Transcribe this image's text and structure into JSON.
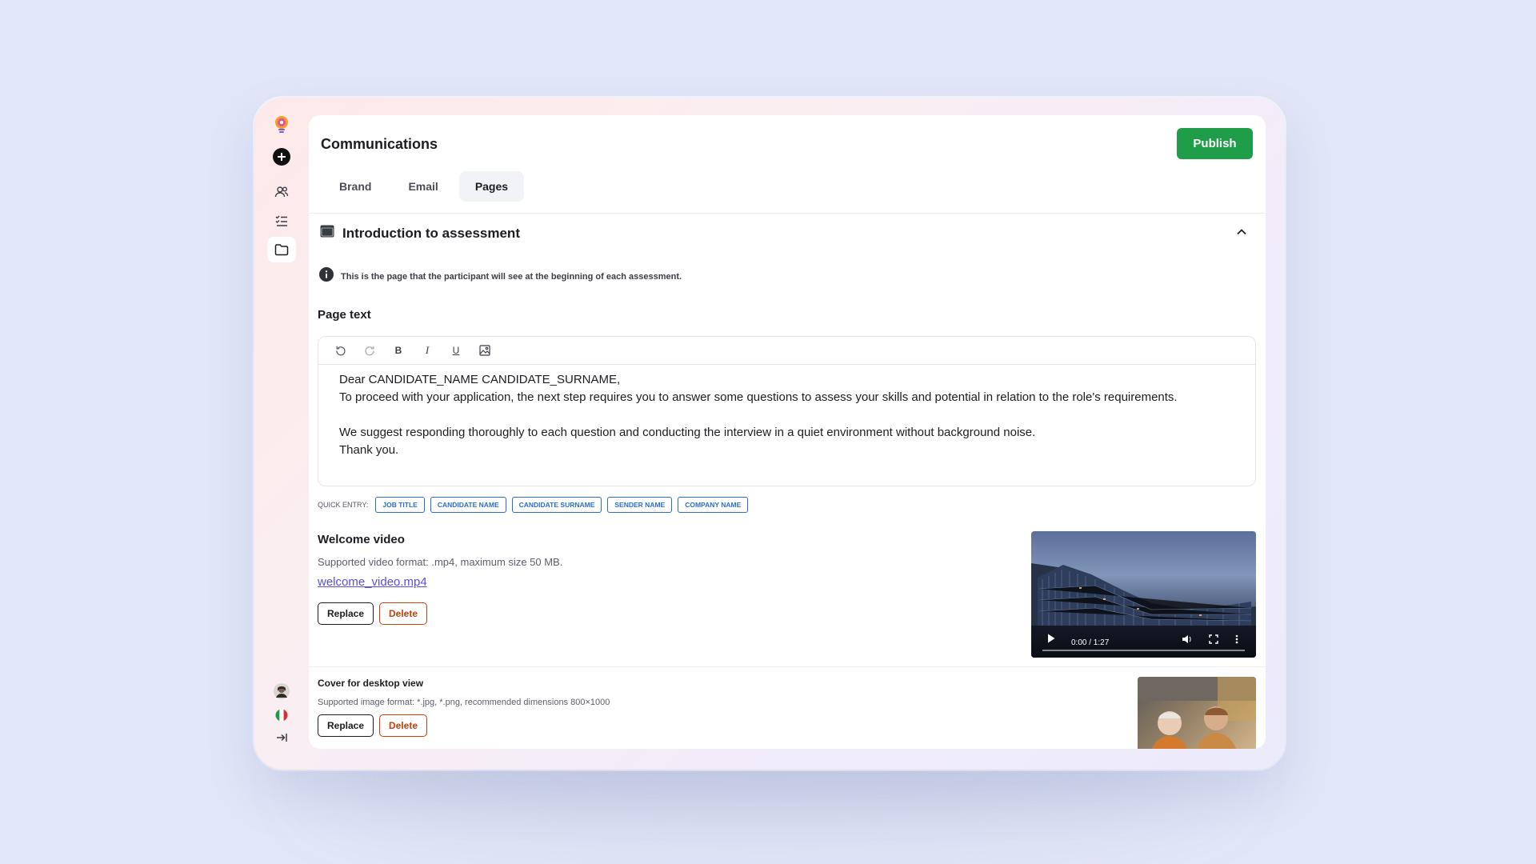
{
  "header": {
    "title": "Communications",
    "publish_label": "Publish"
  },
  "tabs": [
    {
      "label": "Brand",
      "active": false
    },
    {
      "label": "Email",
      "active": false
    },
    {
      "label": "Pages",
      "active": true
    }
  ],
  "section": {
    "title": "Introduction to assessment",
    "info": "This is the page that the participant will see at the beginning of each assessment."
  },
  "page_text": {
    "label": "Page text",
    "toolbar": [
      "undo-icon",
      "redo-icon",
      "bold-icon",
      "italic-icon",
      "underline-icon",
      "image-icon"
    ],
    "lines": [
      "Dear CANDIDATE_NAME CANDIDATE_SURNAME,",
      "To proceed with your application, the next step requires you to answer some questions to assess your skills and potential in relation to the role's requirements.",
      "",
      "We suggest responding thoroughly to each question and conducting the interview in a quiet environment without background noise.",
      "Thank you."
    ]
  },
  "quick_entry": {
    "label": "QUICK ENTRY:",
    "chips": [
      "JOB TITLE",
      "CANDIDATE NAME",
      "CANDIDATE SURNAME",
      "SENDER NAME",
      "COMPANY NAME"
    ]
  },
  "welcome_video": {
    "title": "Welcome video",
    "hint": "Supported video format: .mp4, maximum size 50 MB.",
    "file": "welcome_video.mp4",
    "replace_label": "Replace",
    "delete_label": "Delete",
    "time": "0:00 / 1:27"
  },
  "cover": {
    "title": "Cover for desktop view",
    "hint": "Supported image format: *.jpg, *.png, recommended dimensions 800×1000",
    "replace_label": "Replace",
    "delete_label": "Delete"
  },
  "rail": {
    "top_icons": [
      "logo-icon",
      "add-icon",
      "users-icon",
      "checklist-icon",
      "folder-icon"
    ],
    "bottom_icons": [
      "user-avatar",
      "italy-flag-icon",
      "collapse-sidebar-icon"
    ]
  },
  "colors": {
    "accent_green": "#1f9d48",
    "chip_blue": "#2c6fcb",
    "delete_red": "#c2410c",
    "link_purple": "#5b4fd6"
  }
}
